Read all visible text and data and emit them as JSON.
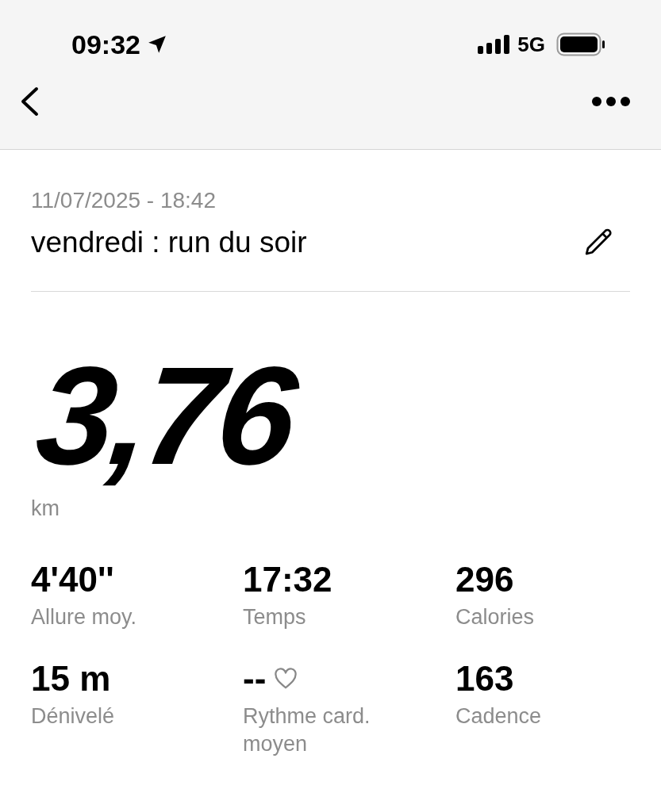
{
  "status_bar": {
    "time": "09:32",
    "network": "5G"
  },
  "activity": {
    "date": "11/07/2025 - 18:42",
    "title": "vendredi : run du soir"
  },
  "distance": {
    "value": "3,76",
    "unit": "km"
  },
  "stats": [
    {
      "kind": "plain",
      "value": "4'40''",
      "label": "Allure moy."
    },
    {
      "kind": "plain",
      "value": "17:32",
      "label": "Temps"
    },
    {
      "kind": "plain",
      "value": "296",
      "label": "Calories"
    },
    {
      "kind": "plain",
      "value": "15 m",
      "label": "Dénivelé"
    },
    {
      "kind": "heartrate",
      "value": "--",
      "label": "Rythme card. moyen"
    },
    {
      "kind": "plain",
      "value": "163",
      "label": "Cadence"
    }
  ]
}
